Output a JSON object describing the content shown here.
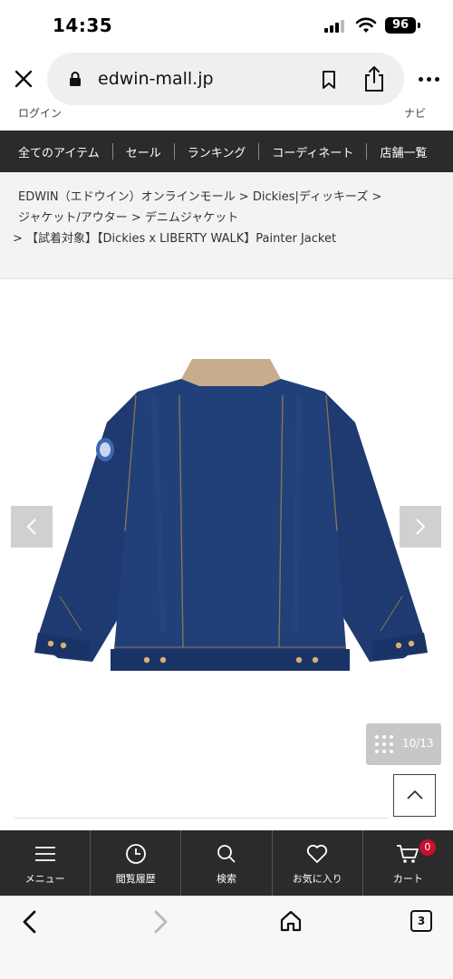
{
  "status_bar": {
    "time": "14:35",
    "battery": "96"
  },
  "browser": {
    "url": "edwin-mall.jp"
  },
  "header_strip": {
    "left": "ログイン",
    "right": "ナビ"
  },
  "category_nav": {
    "items": [
      "全てのアイテム",
      "セール",
      "ランキング",
      "コーディネート",
      "店舗一覧"
    ]
  },
  "breadcrumb": {
    "items": [
      "EDWIN（エドウイン）オンラインモール",
      "Dickies|ディッキーズ",
      "ジャケット/アウター",
      "デニムジャケット",
      "【試着対象】【Dickies x LIBERTY WALK】Painter Jacket"
    ],
    "separator": ">"
  },
  "gallery": {
    "counter": "10/13"
  },
  "site_tabbar": {
    "tabs": [
      {
        "label": "メニュー",
        "icon": "hamburger-icon"
      },
      {
        "label": "閲覧履歴",
        "icon": "clock-icon"
      },
      {
        "label": "検索",
        "icon": "search-icon"
      },
      {
        "label": "お気に入り",
        "icon": "heart-icon"
      },
      {
        "label": "カート",
        "icon": "cart-icon"
      }
    ],
    "cart_count": "0"
  },
  "safari_toolbar": {
    "tab_count": "3"
  },
  "colors": {
    "nav_bg": "#2b2b2b",
    "badge": "#c8102e",
    "denim": "#1f3a72",
    "collar": "#c8ad8c"
  }
}
